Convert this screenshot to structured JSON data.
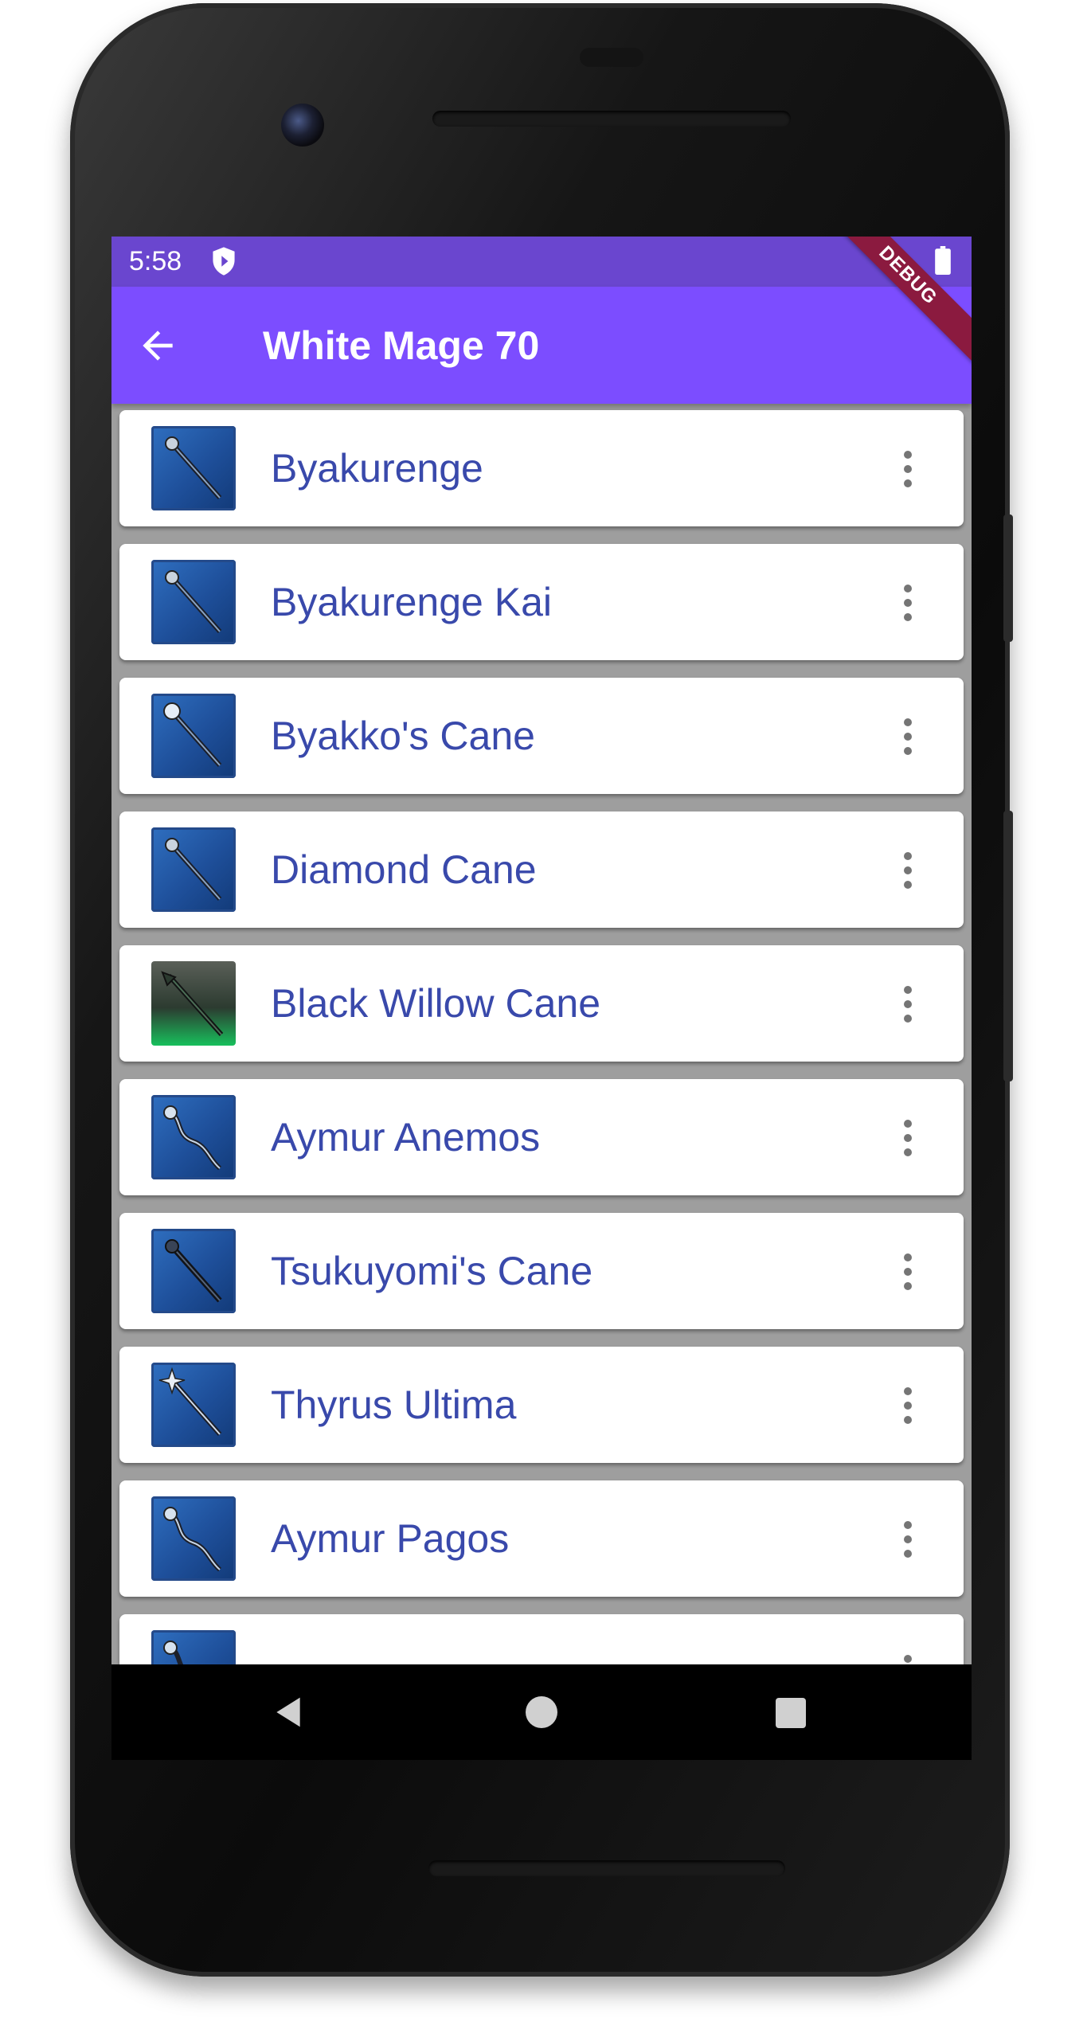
{
  "status_bar": {
    "time": "5:58",
    "icons": [
      "shield-play-icon",
      "battery-icon"
    ]
  },
  "app_bar": {
    "title": "White Mage 70",
    "back_icon": "arrow-back-icon",
    "banner": "DEBUG"
  },
  "colors": {
    "app_bar": "#7c4dff",
    "status_bar": "#6a46cf",
    "item_text": "#3949ab",
    "list_background": "#9e9e9e",
    "debug_banner": "#8b1a3f"
  },
  "items": [
    {
      "name": "Byakurenge",
      "icon": "staff-icon",
      "menu_icon": "more-vert-icon"
    },
    {
      "name": "Byakurenge Kai",
      "icon": "staff-icon",
      "menu_icon": "more-vert-icon"
    },
    {
      "name": "Byakko's Cane",
      "icon": "staff-icon",
      "menu_icon": "more-vert-icon"
    },
    {
      "name": "Diamond Cane",
      "icon": "staff-icon",
      "menu_icon": "more-vert-icon"
    },
    {
      "name": "Black Willow Cane",
      "icon": "staff-icon",
      "menu_icon": "more-vert-icon"
    },
    {
      "name": "Aymur Anemos",
      "icon": "staff-icon",
      "menu_icon": "more-vert-icon"
    },
    {
      "name": "Tsukuyomi's Cane",
      "icon": "staff-icon",
      "menu_icon": "more-vert-icon"
    },
    {
      "name": "Thyrus Ultima",
      "icon": "staff-icon",
      "menu_icon": "more-vert-icon"
    },
    {
      "name": "Aymur Pagos",
      "icon": "staff-icon",
      "menu_icon": "more-vert-icon"
    }
  ],
  "nav_bar": {
    "icons": [
      "nav-back-icon",
      "nav-home-icon",
      "nav-recents-icon"
    ]
  }
}
